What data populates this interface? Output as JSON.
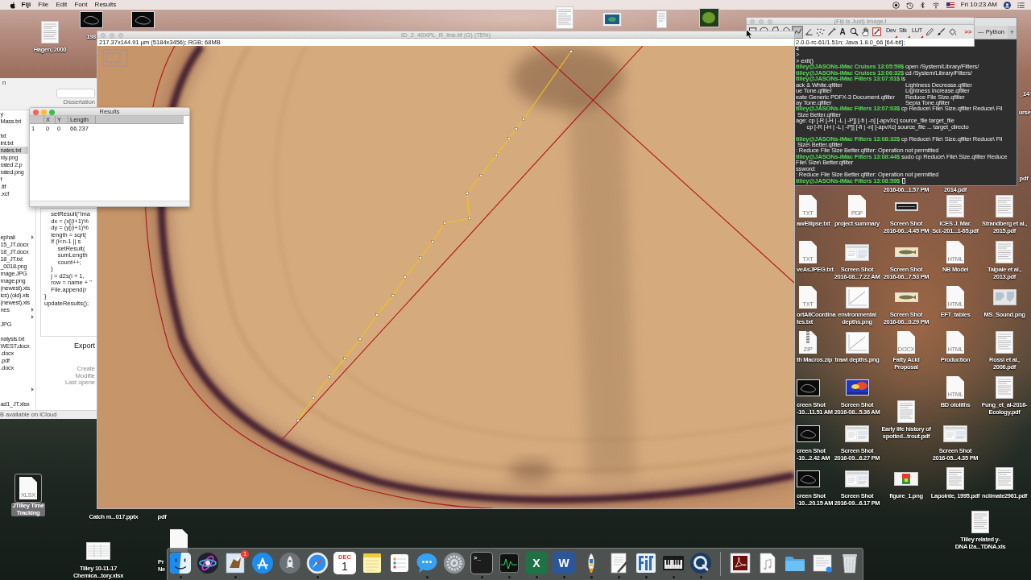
{
  "menu_bar": {
    "app_name": "Fiji",
    "menus": [
      "File",
      "Edit",
      "Font",
      "Results"
    ],
    "clock": "Fri 10:23 AM"
  },
  "desktop_icons": [
    {
      "kind": "paper",
      "label": [
        "Hagen, 2000"
      ],
      "selected": false
    },
    {
      "kind": "dark",
      "label": [
        "198"
      ],
      "selected": false
    },
    {
      "kind": "dark",
      "selected": false
    },
    {
      "kind": "paper",
      "selected": false
    },
    {
      "kind": "blue_shot",
      "selected": false
    },
    {
      "kind": "narrow",
      "selected": false
    },
    {
      "kind": "green_photo",
      "selected": false
    },
    {
      "label": [
        "_14"
      ],
      "selected": false
    },
    {
      "label": [
        "urse"
      ],
      "selected": false
    },
    {
      "label": [
        "pdf"
      ],
      "selected": false
    },
    {
      "label": [
        "2016-06...1.57 PM"
      ],
      "selected": false
    },
    {
      "label": [
        "2014.pdf"
      ],
      "selected": false
    },
    {
      "kind": "generic",
      "type_label": "TXT",
      "label": [
        "awEllipse.txt"
      ],
      "selected": false
    },
    {
      "kind": "generic",
      "type_label": "PDF",
      "label": [
        "project summary"
      ],
      "selected": false
    },
    {
      "kind": "strip",
      "label": [
        "Screen Shot",
        "2016-06...4.45 PM"
      ],
      "selected": false
    },
    {
      "kind": "paper",
      "label": [
        "ICES J. Mar.",
        "Sci.-201...1-65.pdf"
      ],
      "selected": false
    },
    {
      "kind": "paper",
      "label": [
        "Strandberg et al.,",
        "2015.pdf"
      ],
      "selected": false
    },
    {
      "kind": "generic",
      "type_label": "TXT",
      "label": [
        "veAsJPEG.txt"
      ],
      "selected": false
    },
    {
      "kind": "screenshot",
      "label": [
        "Screen Shot",
        "2016-08...7.22 AM"
      ],
      "selected": false
    },
    {
      "kind": "photo",
      "label": [
        "Screen Shot",
        "2016-06...7.53 PM"
      ],
      "selected": false
    },
    {
      "kind": "generic",
      "type_label": "HTML",
      "label": [
        "NB Model"
      ],
      "selected": false
    },
    {
      "kind": "paper",
      "label": [
        "Taipale et al.,",
        "2013.pdf"
      ],
      "selected": false
    },
    {
      "kind": "generic",
      "type_label": "TXT",
      "label": [
        "ortAllCoordina",
        "tes.txt"
      ],
      "selected": false
    },
    {
      "kind": "chart",
      "label": [
        "environmental",
        "depths.png"
      ],
      "selected": false
    },
    {
      "kind": "photo",
      "label": [
        "Screen Shot",
        "2016-06...0.29 PM"
      ],
      "selected": false
    },
    {
      "kind": "generic",
      "type_label": "HTML",
      "label": [
        "EFT_tables"
      ],
      "selected": false
    },
    {
      "kind": "map",
      "label": [
        "MS_Sound.png"
      ],
      "selected": false
    },
    {
      "kind": "zip",
      "type_label": "ZIP",
      "label": [
        "th Macros.zip"
      ],
      "selected": false
    },
    {
      "kind": "chart",
      "label": [
        "trawl depths.png"
      ],
      "selected": false
    },
    {
      "kind": "generic",
      "type_label": "DOCX",
      "label": [
        "Fatty Acid",
        "Proposal"
      ],
      "selected": false
    },
    {
      "kind": "generic",
      "type_label": "HTML",
      "label": [
        "Production"
      ],
      "selected": false
    },
    {
      "kind": "paper",
      "label": [
        "Rossi et al.,",
        "2006.pdf"
      ],
      "selected": false
    },
    {
      "kind": "dark",
      "label": [
        "creen Shot",
        "-10...11.51 AM"
      ],
      "selected": false
    },
    {
      "kind": "heatmap",
      "label": [
        "Screen Shot",
        "2016-08...5.36 AM"
      ],
      "selected": false
    },
    {
      "kind": "generic",
      "type_label": "HTML",
      "label": [
        "BD otoliths"
      ],
      "selected": false
    },
    {
      "kind": "paper",
      "label": [
        "Fung_et_al-2016-",
        "Ecology.pdf"
      ],
      "selected": false
    },
    {
      "kind": "paper",
      "label": [
        "Early life history of",
        "spotted...trout.pdf"
      ],
      "selected": false
    },
    {
      "kind": "dark",
      "label": [
        "creen Shot",
        "-10...2.42 AM"
      ],
      "selected": false
    },
    {
      "kind": "screenshot",
      "label": [
        "Screen Shot",
        "2016-09...6.27 PM"
      ],
      "selected": false
    },
    {
      "kind": "screenshot",
      "label": [
        "Screen Shot",
        "2016-05...4.35 PM"
      ],
      "selected": false
    },
    {
      "kind": "dark",
      "label": [
        "creen Shot",
        "-10...20.15 AM"
      ],
      "selected": false
    },
    {
      "kind": "screenshot",
      "label": [
        "Screen Shot",
        "2016-09...6.17 PM"
      ],
      "selected": false
    },
    {
      "kind": "figure",
      "label": [
        "figure_1.png"
      ],
      "selected": false
    },
    {
      "kind": "paper",
      "label": [
        "Lapointe, 1995.pdf"
      ],
      "selected": false
    },
    {
      "kind": "paper",
      "label": [
        "nclimate2961.pdf"
      ],
      "selected": false
    },
    {
      "kind": "paper",
      "label": [
        "Tilley related y-",
        "DNA I2a...TDNA.xls"
      ],
      "selected": false
    },
    {
      "kind": "generic",
      "type_label": "XLSX",
      "label": [
        "JTilley Time",
        "Tracking"
      ],
      "selected": true
    },
    {
      "label": [
        "Catch m...017.pptx"
      ],
      "selected": false
    },
    {
      "label": [
        "pdf"
      ],
      "selected": false
    },
    {
      "kind": "sheet",
      "label": [
        "Tilley 10-11-17",
        "Chemica...tory.xlsx"
      ],
      "selected": false
    },
    {
      "kind": "generic",
      "selected": false
    },
    {
      "label": [
        "Pr",
        "Ne"
      ],
      "selected": false
    }
  ],
  "finder_window": {
    "title_fragment": "n",
    "column_header": "Dissertation",
    "files": [
      {
        "name": "y",
        "selected": false,
        "folder": false
      },
      {
        "name": "Mass.txt",
        "selected": false,
        "folder": false
      },
      {
        "name": "txt",
        "selected": false,
        "folder": false
      },
      {
        "name": "int.txt",
        "selected": false,
        "folder": false
      },
      {
        "name": "nates.txt",
        "selected": true,
        "folder": false
      },
      {
        "name": "nly.png",
        "selected": false,
        "folder": false
      },
      {
        "name": "rated 2.p",
        "selected": false,
        "folder": false
      },
      {
        "name": "rated.png",
        "selected": false,
        "folder": false
      },
      {
        "name": "f",
        "selected": false,
        "folder": false
      },
      {
        "name": ".tif",
        "selected": false,
        "folder": false
      },
      {
        "name": ".xcf",
        "selected": false,
        "folder": false
      },
      {
        "name": "ephali",
        "selected": false,
        "folder": true
      },
      {
        "name": "15_JT.docx",
        "selected": false,
        "folder": false
      },
      {
        "name": "18_JT.docx",
        "selected": false,
        "folder": false
      },
      {
        "name": "18_JT.txt",
        "selected": false,
        "folder": false
      },
      {
        "name": "_0018.png",
        "selected": false,
        "folder": false
      },
      {
        "name": "mage.JPG",
        "selected": false,
        "folder": false
      },
      {
        "name": "mage.png",
        "selected": false,
        "folder": false
      },
      {
        "name": "(newest).xls",
        "selected": false,
        "folder": false
      },
      {
        "name": "ics) (old).xls",
        "selected": false,
        "folder": false
      },
      {
        "name": "(newest).xls",
        "selected": false,
        "folder": false
      },
      {
        "name": "nes",
        "selected": false,
        "folder": true
      },
      {
        "selected": false,
        "folder": true
      },
      {
        "name": "JPG",
        "selected": false,
        "folder": false
      },
      {
        "name": "nalysis.txt",
        "selected": false,
        "folder": false
      },
      {
        "name": "WEST.docx",
        "selected": false,
        "folder": false
      },
      {
        "name": ".docx",
        "selected": false,
        "folder": false
      },
      {
        "name": ".pdf",
        "selected": false,
        "folder": false
      },
      {
        "name": ".docx",
        "selected": false,
        "folder": false
      },
      {
        "selected": false,
        "folder": true
      },
      {
        "name": "ad1_JT.xlsx",
        "selected": false,
        "folder": false
      }
    ],
    "preview": {
      "code": [
        "    setResult(\"ima",
        "    dx = (x[(i+1)%",
        "    dy = (y[(i+1)%",
        "    length = sqrt(",
        "    if (i<n-1 || s",
        "        setResult(",
        "        sumLength",
        "        count++;",
        "    }",
        "    j = d2s(i + 1,",
        "    row = name + \"",
        "    File.append(r",
        "}",
        "updateResults();"
      ],
      "heading": "Export",
      "meta_labels": [
        "Create",
        "Modifie",
        "Last opene"
      ]
    },
    "storage_status": "B available on iCloud"
  },
  "terminal": {
    "title": "— Python",
    "new_tab": "+",
    "lines": [
      {
        "kind": "output",
        "text": "4"
      },
      {
        "kind": "output",
        "text": ">"
      },
      {
        "kind": "output",
        "text": "> exit()"
      },
      {
        "kind": "prompt",
        "prompt": "tilley@JASONs-iMac Cruises 13:05:59$",
        "command": " open /System/Library/Filters/"
      },
      {
        "kind": "prompt",
        "prompt": "tilley@JASONs-iMac Cruises 13:06:32$",
        "command": " cd /System/Library/Filters/"
      },
      {
        "kind": "prompt",
        "prompt": "tilley@JASONs-iMac Filters 13:07:01$",
        "command": " ls"
      },
      {
        "kind": "columns",
        "cells": [
          "ack & White.qfilter",
          "Lightness Decrease.qfilter"
        ]
      },
      {
        "kind": "columns",
        "cells": [
          "ue Tone.qfilter",
          "Lightness Increase.qfilter"
        ]
      },
      {
        "kind": "columns",
        "cells": [
          "eate Generic PDFX-3 Document.qfilter",
          "Reduce File Size.qfilter"
        ]
      },
      {
        "kind": "columns",
        "cells": [
          "ay Tone.qfilter",
          "Sepia Tone.qfilter"
        ]
      },
      {
        "kind": "prompt",
        "prompt": "tilley@JASONs-iMac Filters 13:07:03$",
        "command": " cp Reduce\\ File\\ Size.qfilter Reduce\\ Fil"
      },
      {
        "kind": "output",
        "text": " Size Better.qfilter"
      },
      {
        "kind": "output",
        "text": "age: cp [-R [-H | -L | -P]] [-fi | -n] [-apvXc] source_file target_file"
      },
      {
        "kind": "output",
        "text": "       cp [-R [-H | -L | -P]] [-fi | -n] [-apvXc] source_file ... target_directo"
      },
      {
        "kind": "blank"
      },
      {
        "kind": "prompt",
        "prompt": "tilley@JASONs-iMac Filters 13:08:32$",
        "command": " cp Reduce\\ File\\ Size.qfilter Reduce\\ Fil"
      },
      {
        "kind": "output",
        "text": " Size\\ Better.qfilter"
      },
      {
        "kind": "output",
        "text": ": Reduce File Size Better.qfilter: Operation not permitted"
      },
      {
        "kind": "prompt",
        "prompt": "tilley@JASONs-iMac Filters 13:08:44$",
        "command": " sudo cp Reduce\\ File\\ Size.qfilter Reduce"
      },
      {
        "kind": "output",
        "text": "File\\ Size\\ Better.qfilter"
      },
      {
        "kind": "output",
        "text": "ssword:"
      },
      {
        "kind": "output",
        "text": ": Reduce File Size Better.qfilter: Operation not permitted"
      },
      {
        "kind": "prompt",
        "prompt": "tilley@JASONs-iMac Filters 13:08:59$",
        "cursor": true
      }
    ]
  },
  "imagej_toolbar": {
    "title": "(Fiji Is Just) ImageJ",
    "active": false,
    "tools": [
      {
        "kind": "rectangle",
        "selected": false
      },
      {
        "kind": "oval",
        "selected": false
      },
      {
        "kind": "polygon",
        "selected": false
      },
      {
        "kind": "freehand",
        "selected": false
      },
      {
        "kind": "segmented_line",
        "selected": true
      },
      {
        "kind": "angle",
        "selected": false
      },
      {
        "kind": "point",
        "selected": false
      },
      {
        "kind": "wand",
        "selected": false
      },
      {
        "kind": "text",
        "label": "A",
        "selected": false
      },
      {
        "kind": "zoom",
        "selected": false
      },
      {
        "kind": "hand",
        "selected": false
      },
      {
        "kind": "color_picker",
        "selected": false
      },
      {
        "kind": "menu",
        "label": "Dev",
        "selected": false
      },
      {
        "kind": "menu",
        "label": "Stk",
        "selected": false
      },
      {
        "kind": "menu",
        "label": "LUT",
        "selected": false
      },
      {
        "kind": "pencil",
        "selected": false
      },
      {
        "kind": "brush",
        "selected": false
      },
      {
        "kind": "flood_fill",
        "selected": false
      },
      {
        "kind": "more",
        "label": ">>",
        "selected": false
      }
    ],
    "status": "2.0.0-rc-61/1.51n; Java 1.8.0_66 [64-bit];"
  },
  "image_window": {
    "title": "ID_2_40XPL_R_line.tif (G) (75%)",
    "info": "217.37x144.91 µm (5184x3456); RGB; 68MB",
    "active": false
  },
  "results_window": {
    "title": "Results",
    "active": true,
    "columns": [
      "X",
      "Y",
      "Length"
    ],
    "rows": [
      {
        "index": "1",
        "cells": [
          "0",
          "0",
          "66.237"
        ]
      }
    ]
  },
  "dock": {
    "apps": [
      {
        "kind": "finder",
        "running": true
      },
      {
        "kind": "siri",
        "running": false
      },
      {
        "kind": "mail",
        "running": true,
        "badge": "1"
      },
      {
        "kind": "appstore",
        "running": false
      },
      {
        "kind": "launchpad",
        "running": false
      },
      {
        "kind": "safari",
        "running": true
      },
      {
        "kind": "calendar",
        "month": "DEC",
        "day": "1",
        "running": false
      },
      {
        "kind": "notes",
        "running": false
      },
      {
        "kind": "reminders",
        "running": false
      },
      {
        "kind": "messages",
        "running": true
      },
      {
        "kind": "settings",
        "running": false
      },
      {
        "kind": "terminal",
        "glyph": ">_",
        "running": true
      },
      {
        "kind": "activity",
        "running": true
      },
      {
        "kind": "excel",
        "glyph": "X",
        "running": true
      },
      {
        "kind": "word",
        "glyph": "W",
        "running": true
      },
      {
        "kind": "python",
        "running": true
      },
      {
        "kind": "textedit",
        "running": true
      },
      {
        "kind": "fiji",
        "running": true
      },
      {
        "kind": "piano",
        "running": true
      },
      {
        "kind": "quicktime",
        "running": true
      }
    ],
    "others": [
      {
        "kind": "pdf_window"
      },
      {
        "kind": "music_doc"
      },
      {
        "kind": "folder"
      },
      {
        "kind": "doc_stack"
      },
      {
        "kind": "trash"
      }
    ]
  }
}
